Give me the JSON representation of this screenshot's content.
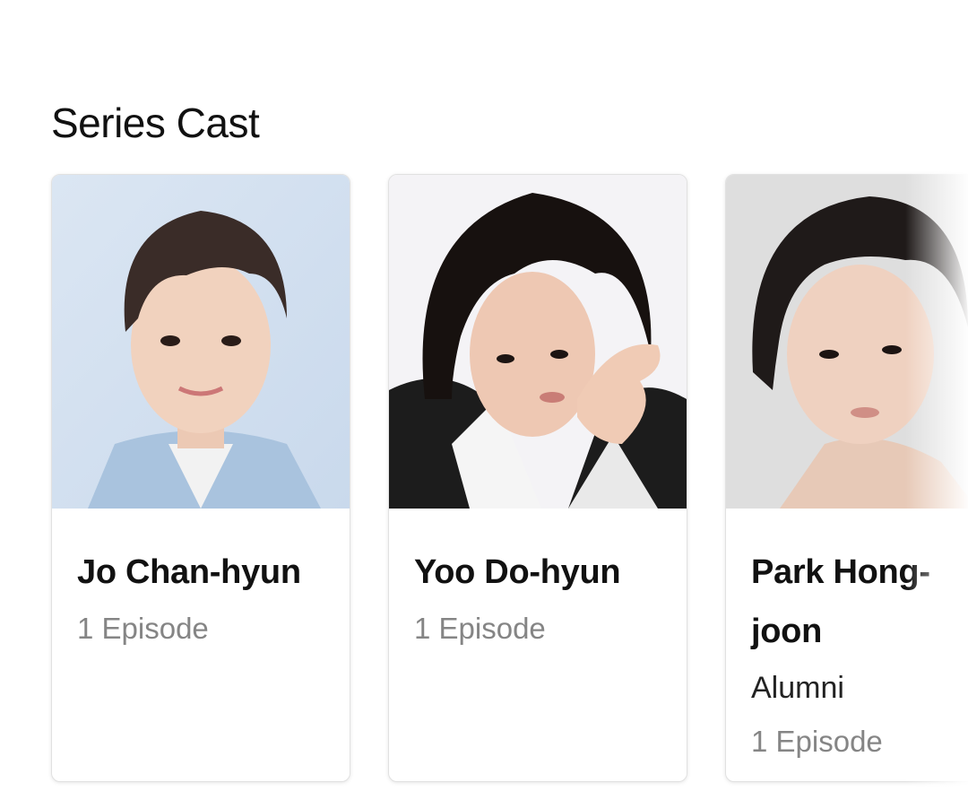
{
  "section": {
    "title": "Series Cast"
  },
  "cast": [
    {
      "name": "Jo Chan-hyun",
      "role": "",
      "episodes": "1 Episode"
    },
    {
      "name": "Yoo Do-hyun",
      "role": "",
      "episodes": "1 Episode"
    },
    {
      "name": "Park Hong-joon",
      "role": "Alumni",
      "episodes": "1 Episode"
    }
  ],
  "colors": {
    "card_border": "#e1e1e1",
    "episode_text": "#858585",
    "title_text": "#111111"
  }
}
